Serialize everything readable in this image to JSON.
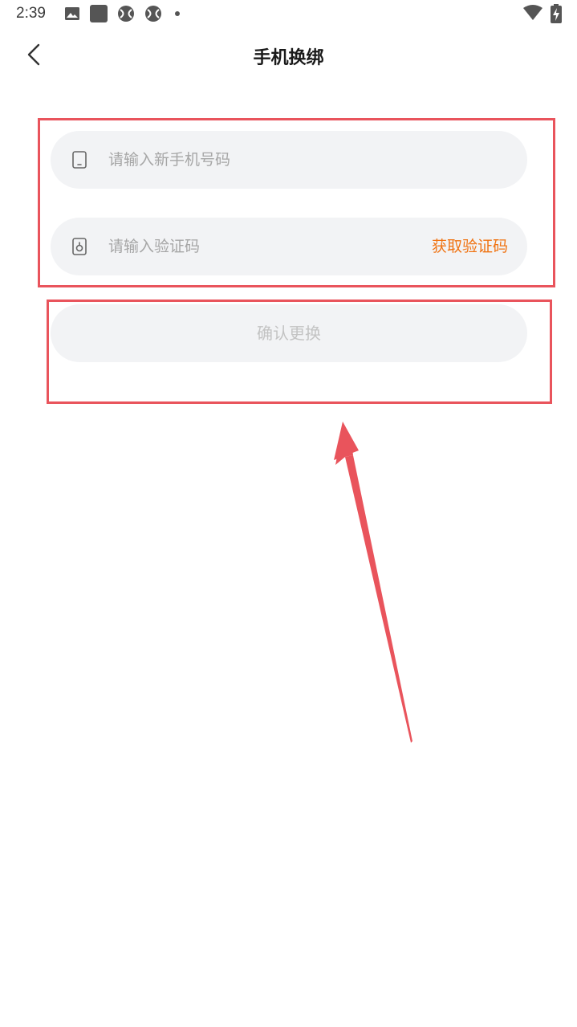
{
  "status_bar": {
    "time": "2:39",
    "icons": [
      "image-icon",
      "square-app-icon",
      "ball-icon",
      "ball-icon",
      "dot-icon",
      "wifi-icon",
      "battery-charging-icon"
    ]
  },
  "header": {
    "title": "手机换绑",
    "back_icon": "chevron-left-icon"
  },
  "form": {
    "phone": {
      "icon": "phone-icon",
      "placeholder": "请输入新手机号码",
      "value": ""
    },
    "code": {
      "icon": "lock-code-icon",
      "placeholder": "请输入验证码",
      "value": "",
      "get_code_label": "获取验证码"
    },
    "confirm_label": "确认更换"
  },
  "colors": {
    "accent": "#f07312",
    "field_bg": "#f2f3f5",
    "disabled_text": "#c3c3c3",
    "placeholder": "#a6a6a6",
    "annotation": "#e9545c"
  }
}
